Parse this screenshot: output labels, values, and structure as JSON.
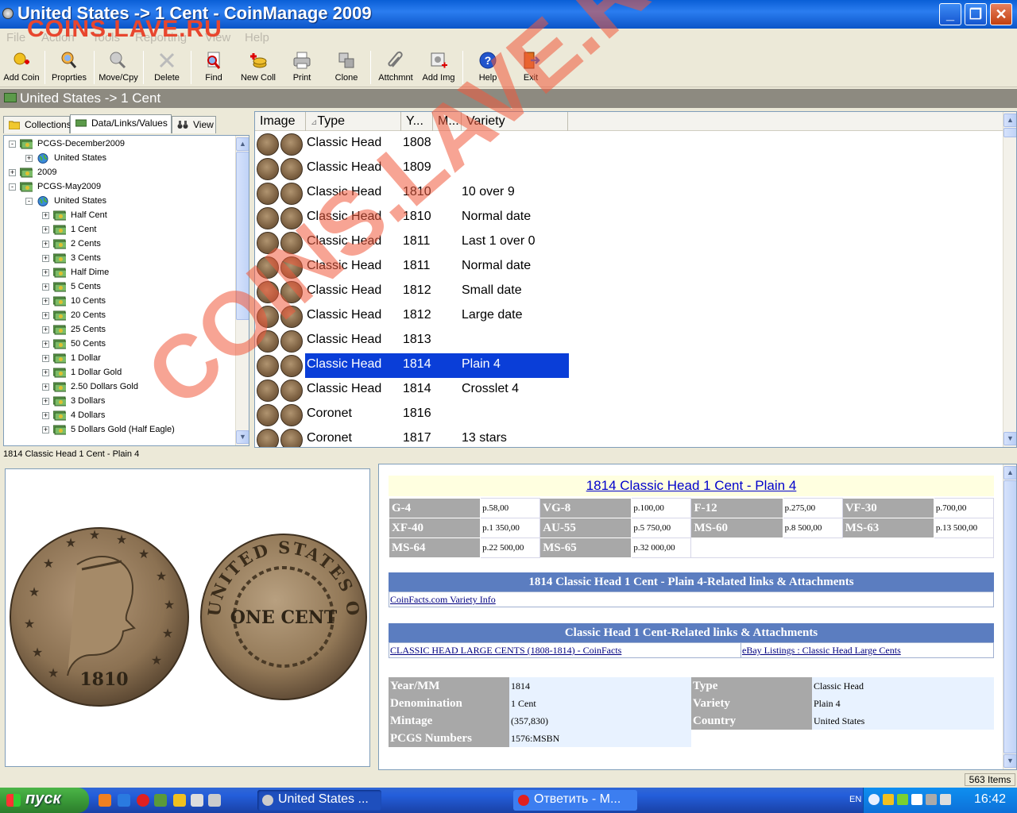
{
  "window": {
    "title": "United States -> 1 Cent - CoinManage 2009"
  },
  "watermark": {
    "top": "COINS.LAVE.RU",
    "diagonal": "COINS.LAVE.RU"
  },
  "menu": [
    "File",
    "Action",
    "Tools",
    "Reporting",
    "View",
    "Help"
  ],
  "toolbar": [
    {
      "label": "Add Coin",
      "icon": "add-coin-icon"
    },
    {
      "label": "Proprties",
      "icon": "properties-icon"
    },
    {
      "label": "Move/Cpy",
      "icon": "move-copy-icon"
    },
    {
      "label": "Delete",
      "icon": "delete-icon"
    },
    {
      "label": "Find",
      "icon": "find-icon"
    },
    {
      "label": "New Coll",
      "icon": "new-collection-icon"
    },
    {
      "label": "Print",
      "icon": "print-icon"
    },
    {
      "label": "Clone",
      "icon": "clone-icon"
    },
    {
      "label": "Attchmnt",
      "icon": "attachment-icon"
    },
    {
      "label": "Add Img",
      "icon": "add-image-icon"
    },
    {
      "label": "Help",
      "icon": "help-icon"
    },
    {
      "label": "Exit",
      "icon": "exit-icon"
    }
  ],
  "path": "United States -> 1 Cent",
  "tabs": [
    "Collections",
    "Data/Links/Values",
    "View"
  ],
  "tree": [
    {
      "label": "PCGS-December2009",
      "level": 0,
      "exp": "-"
    },
    {
      "label": "United States",
      "level": 1,
      "exp": "+"
    },
    {
      "label": "2009",
      "level": 0,
      "exp": "+"
    },
    {
      "label": "PCGS-May2009",
      "level": 0,
      "exp": "-"
    },
    {
      "label": "United States",
      "level": 1,
      "exp": "-"
    },
    {
      "label": "Half Cent",
      "level": 2,
      "exp": "+"
    },
    {
      "label": "1 Cent",
      "level": 2,
      "exp": "+"
    },
    {
      "label": "2 Cents",
      "level": 2,
      "exp": "+"
    },
    {
      "label": "3 Cents",
      "level": 2,
      "exp": "+"
    },
    {
      "label": "Half Dime",
      "level": 2,
      "exp": "+"
    },
    {
      "label": "5 Cents",
      "level": 2,
      "exp": "+"
    },
    {
      "label": "10 Cents",
      "level": 2,
      "exp": "+"
    },
    {
      "label": "20 Cents",
      "level": 2,
      "exp": "+"
    },
    {
      "label": "25 Cents",
      "level": 2,
      "exp": "+"
    },
    {
      "label": "50 Cents",
      "level": 2,
      "exp": "+"
    },
    {
      "label": "1 Dollar",
      "level": 2,
      "exp": "+"
    },
    {
      "label": "1 Dollar Gold",
      "level": 2,
      "exp": "+"
    },
    {
      "label": "2.50 Dollars Gold",
      "level": 2,
      "exp": "+"
    },
    {
      "label": "3 Dollars",
      "level": 2,
      "exp": "+"
    },
    {
      "label": "4 Dollars",
      "level": 2,
      "exp": "+"
    },
    {
      "label": "5 Dollars Gold (Half Eagle)",
      "level": 2,
      "exp": "+"
    }
  ],
  "grid": {
    "headers": [
      "Image",
      "Type",
      "Y...",
      "M...",
      "Variety"
    ],
    "rows": [
      {
        "type": "Classic Head",
        "year": "1808",
        "variety": ""
      },
      {
        "type": "Classic Head",
        "year": "1809",
        "variety": ""
      },
      {
        "type": "Classic Head",
        "year": "1810",
        "variety": "10 over 9"
      },
      {
        "type": "Classic Head",
        "year": "1810",
        "variety": "Normal date"
      },
      {
        "type": "Classic Head",
        "year": "1811",
        "variety": "Last 1 over 0"
      },
      {
        "type": "Classic Head",
        "year": "1811",
        "variety": "Normal date"
      },
      {
        "type": "Classic Head",
        "year": "1812",
        "variety": "Small date"
      },
      {
        "type": "Classic Head",
        "year": "1812",
        "variety": "Large date"
      },
      {
        "type": "Classic Head",
        "year": "1813",
        "variety": ""
      },
      {
        "type": "Classic Head",
        "year": "1814",
        "variety": "Plain 4",
        "selected": true
      },
      {
        "type": "Classic Head",
        "year": "1814",
        "variety": "Crosslet 4"
      },
      {
        "type": "Coronet",
        "year": "1816",
        "variety": ""
      },
      {
        "type": "Coronet",
        "year": "1817",
        "variety": "13 stars"
      }
    ]
  },
  "selected_caption": "1814 Classic Head  1 Cent - Plain 4",
  "coin_image": {
    "obverse_year": "1810",
    "reverse_text": "ONE CENT",
    "legend": "UNITED STATES OF AMERICA"
  },
  "info": {
    "title": "1814 Classic Head 1 Cent - Plain 4",
    "grades": [
      [
        {
          "g": "G-4",
          "p": "p.58,00"
        },
        {
          "g": "VG-8",
          "p": "p.100,00"
        },
        {
          "g": "F-12",
          "p": "p.275,00"
        },
        {
          "g": "VF-30",
          "p": "p.700,00"
        }
      ],
      [
        {
          "g": "XF-40",
          "p": "p.1 350,00"
        },
        {
          "g": "AU-55",
          "p": "p.5 750,00"
        },
        {
          "g": "MS-60",
          "p": "p.8 500,00"
        },
        {
          "g": "MS-63",
          "p": "p.13 500,00"
        }
      ],
      [
        {
          "g": "MS-64",
          "p": "p.22 500,00"
        },
        {
          "g": "MS-65",
          "p": "p.32 000,00"
        }
      ]
    ],
    "section1": {
      "title": "1814 Classic Head 1 Cent - Plain 4-Related links & Attachments",
      "links": [
        "CoinFacts.com Variety Info"
      ]
    },
    "section2": {
      "title": "Classic Head 1 Cent-Related links & Attachments",
      "links": [
        "CLASSIC HEAD LARGE CENTS (1808-1814) - CoinFacts",
        "eBay Listings : Classic Head Large Cents"
      ]
    },
    "details": [
      [
        "Year/MM",
        "1814",
        "Type",
        "Classic Head"
      ],
      [
        "Denomination",
        "1 Cent",
        "Variety",
        "Plain 4"
      ],
      [
        "Mintage",
        "(357,830)",
        "Country",
        "United States"
      ],
      [
        "PCGS Numbers",
        "1576:MSBN",
        "",
        ""
      ]
    ]
  },
  "item_count": "563 Items",
  "taskbar": {
    "start": "пуск",
    "items": [
      "United States ...",
      "Ответить - М..."
    ],
    "lang": "EN",
    "clock": "16:42"
  },
  "colors": {
    "selection": "#0a3ed8",
    "grade_bg": "#a8a8a8",
    "section_head": "#5b7dc0",
    "titlebar": "#0a5fd6"
  }
}
